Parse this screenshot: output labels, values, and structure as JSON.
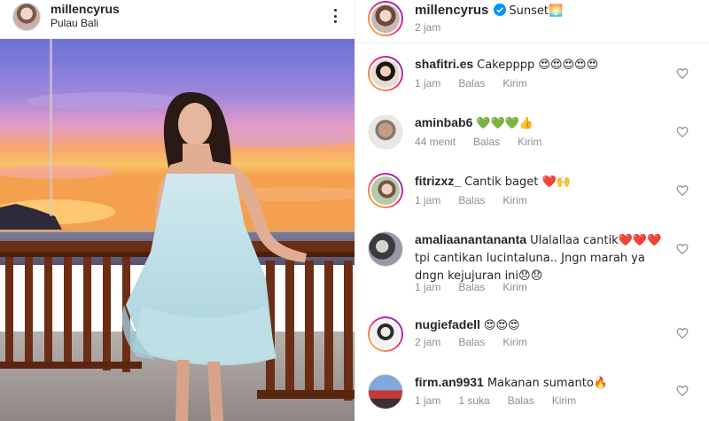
{
  "post": {
    "username": "millencyrus",
    "location": "Pulau Bali"
  },
  "caption": {
    "username": "millencyrus",
    "text": "Sunset🌅",
    "time": "2 jam"
  },
  "labels": {
    "reply": "Balas",
    "send": "Kirim"
  },
  "comments": [
    {
      "username": "shafitri.es",
      "text": "Cakepppp 😍😍😍😍😍",
      "time": "1 jam",
      "likes": ""
    },
    {
      "username": "aminbab6",
      "text": "💚💚💚👍",
      "time": "44 menit",
      "likes": ""
    },
    {
      "username": "fitrizxz_",
      "text": "Cantik baget ❤️🙌",
      "time": "1 jam",
      "likes": ""
    },
    {
      "username": "amaliaanantananta",
      "text": "Ulalallaa cantik❤️❤️❤️ tpi cantikan lucintaluna.. Jngn marah ya dngn kejujuran ini😞😞",
      "time": "1 jam",
      "likes": ""
    },
    {
      "username": "nugiefadell",
      "text": "😍😍😍",
      "time": "2 jam",
      "likes": ""
    },
    {
      "username": "firm.an9931",
      "text": "Makanan sumanto🔥",
      "time": "1 jam",
      "likes": "1 suka"
    }
  ],
  "colors": {
    "accent": "#0095f6",
    "muted": "#8e8e8e",
    "text": "#262626"
  },
  "icons": {
    "more": "more-options-icon",
    "verified": "verified-badge-icon",
    "like": "heart-icon"
  }
}
